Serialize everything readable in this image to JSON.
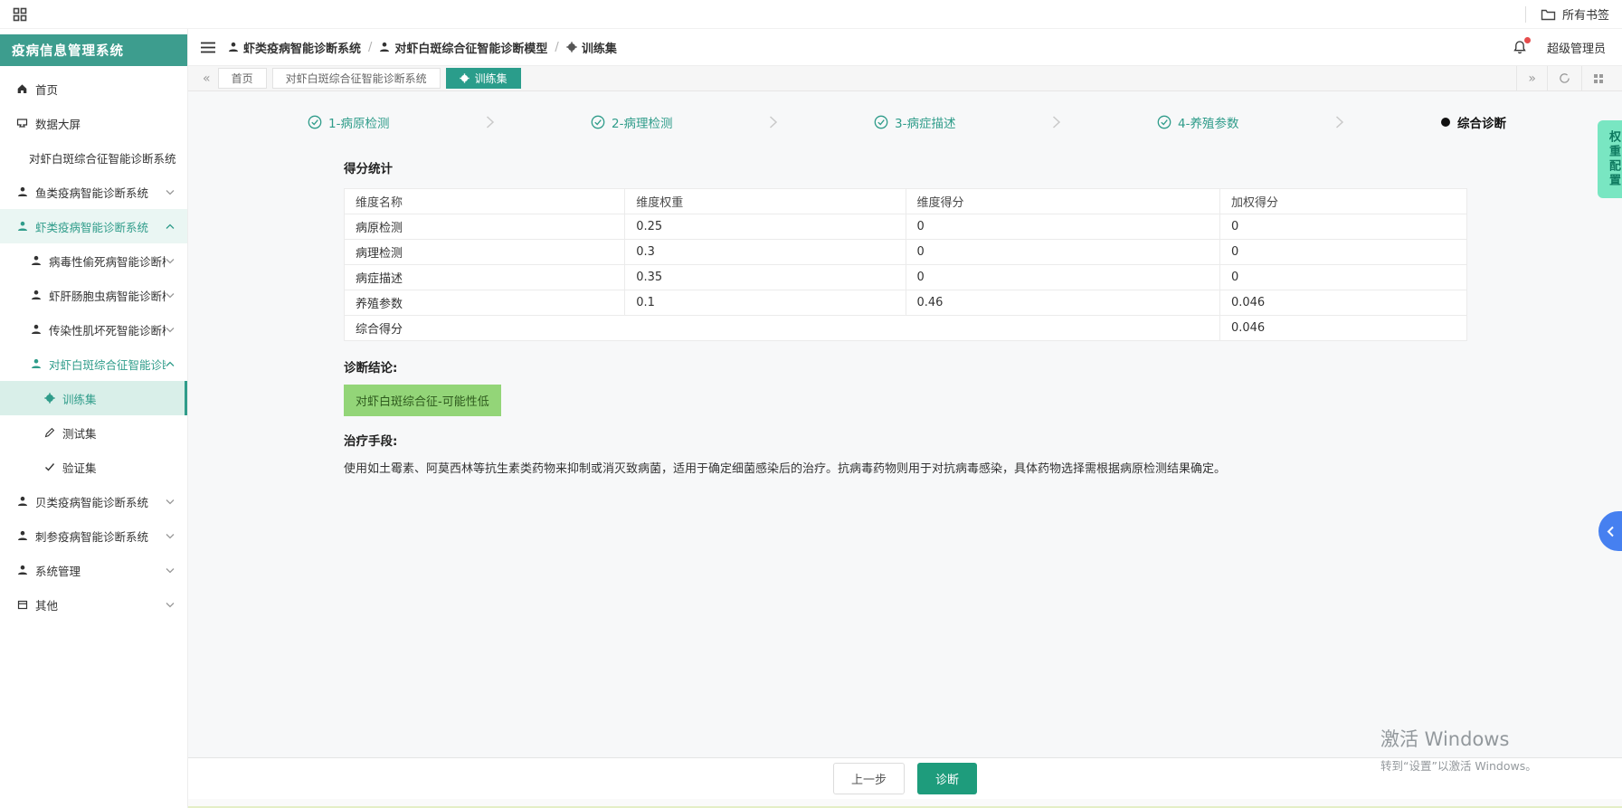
{
  "browser_bar": {
    "bookmarks_label": "所有书签"
  },
  "sidebar": {
    "title": "疫病信息管理系统",
    "items": [
      {
        "label": "首页",
        "icon": "home",
        "level": 1
      },
      {
        "label": "数据大屏",
        "icon": "screen",
        "level": 1
      },
      {
        "label": "对虾白斑综合征智能诊断系统",
        "icon": "none",
        "level": 2
      },
      {
        "label": "鱼类疫病智能诊断系统",
        "icon": "user",
        "level": 1,
        "chevron": "down"
      },
      {
        "label": "虾类疫病智能诊断系统",
        "icon": "user",
        "level": 1,
        "chevron": "up",
        "state": "expanded-highlight"
      },
      {
        "label": "病毒性偷死病智能诊断模型",
        "icon": "user",
        "level": 2,
        "chevron": "down"
      },
      {
        "label": "虾肝肠胞虫病智能诊断模型",
        "icon": "user",
        "level": 2,
        "chevron": "down"
      },
      {
        "label": "传染性肌坏死智能诊断模型",
        "icon": "user",
        "level": 2,
        "chevron": "down"
      },
      {
        "label": "对虾白斑综合征智能诊断模型",
        "icon": "user",
        "level": 2,
        "chevron": "up",
        "state": "expanded"
      },
      {
        "label": "训练集",
        "icon": "dataset",
        "level": 3,
        "state": "active"
      },
      {
        "label": "测试集",
        "icon": "edit",
        "level": 3
      },
      {
        "label": "验证集",
        "icon": "check",
        "level": 3
      },
      {
        "label": "贝类疫病智能诊断系统",
        "icon": "user",
        "level": 1,
        "chevron": "down"
      },
      {
        "label": "刺参疫病智能诊断系统",
        "icon": "user",
        "level": 1,
        "chevron": "down"
      },
      {
        "label": "系统管理",
        "icon": "user",
        "level": 1,
        "chevron": "down"
      },
      {
        "label": "其他",
        "icon": "box",
        "level": 1,
        "chevron": "down"
      }
    ]
  },
  "header": {
    "breadcrumb": [
      {
        "label": "虾类疫病智能诊断系统",
        "icon": "user"
      },
      {
        "label": "对虾白斑综合征智能诊断模型",
        "icon": "user"
      },
      {
        "label": "训练集",
        "icon": "dataset"
      }
    ],
    "separator": "/",
    "user": "超级管理员"
  },
  "tabbar": {
    "back": "«",
    "forward": "»",
    "tabs": [
      {
        "label": "首页",
        "active": false
      },
      {
        "label": "对虾白斑综合征智能诊断系统",
        "active": false
      },
      {
        "label": "训练集",
        "active": true,
        "icon": "dataset"
      }
    ]
  },
  "stepper": {
    "steps": [
      {
        "label": "1-病原检测",
        "state": "done"
      },
      {
        "label": "2-病理检测",
        "state": "done"
      },
      {
        "label": "3-病症描述",
        "state": "done"
      },
      {
        "label": "4-养殖参数",
        "state": "done"
      },
      {
        "label": "综合诊断",
        "state": "current"
      }
    ]
  },
  "score_section": {
    "title": "得分统计",
    "table": {
      "headers": [
        "维度名称",
        "维度权重",
        "维度得分",
        "加权得分"
      ],
      "rows": [
        [
          "病原检测",
          "0.25",
          "0",
          "0"
        ],
        [
          "病理检测",
          "0.3",
          "0",
          "0"
        ],
        [
          "病症描述",
          "0.35",
          "0",
          "0"
        ],
        [
          "养殖参数",
          "0.1",
          "0.46",
          "0.046"
        ],
        [
          "综合得分",
          "",
          "",
          "0.046"
        ]
      ]
    }
  },
  "diagnosis": {
    "label": "诊断结论:",
    "badge": "对虾白斑综合征-可能性低"
  },
  "treatment": {
    "label": "治疗手段:",
    "text": "使用如土霉素、阿莫西林等抗生素类药物来抑制或消灭致病菌，适用于确定细菌感染后的治疗。抗病毒药物则用于对抗病毒感染，具体药物选择需根据病原检测结果确定。"
  },
  "footer": {
    "prev_label": "上一步",
    "diagnose_label": "诊断"
  },
  "floating": {
    "weight_config_label": "权重配置"
  },
  "watermark": {
    "line1": "激活 Windows",
    "line2": "转到“设置”以激活 Windows。"
  },
  "colors": {
    "sidebar_header_bg": "#3d9d8e",
    "primary_teal": "#2f9c8a",
    "active_tab_bg": "#2a9d8b",
    "diagnose_button_bg": "#1e9c7c",
    "badge_bg": "#93d578",
    "badge_text": "#2f5b1e",
    "weight_tag_bg": "#79e6c2",
    "panel_toggle_blue": "#4680f0",
    "notification_red": "#e64c4c"
  }
}
